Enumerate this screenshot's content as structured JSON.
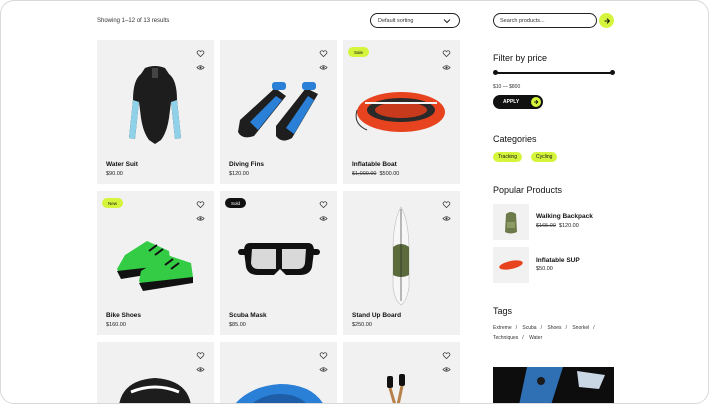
{
  "toolbar": {
    "results_text": "Showing 1–12 of 13 results",
    "sort_value": "Default sorting"
  },
  "products": [
    {
      "name": "Water Suit",
      "price": "$90.00",
      "old_price": "",
      "badge": ""
    },
    {
      "name": "Diving Fins",
      "price": "$120.00",
      "old_price": "",
      "badge": ""
    },
    {
      "name": "Inflatable Boat",
      "price": "$500.00",
      "old_price": "$1,000.00",
      "badge": "Sale"
    },
    {
      "name": "Bike Shoes",
      "price": "$160.00",
      "old_price": "",
      "badge": "New"
    },
    {
      "name": "Scuba Mask",
      "price": "$85.00",
      "old_price": "",
      "badge": "Sold"
    },
    {
      "name": "Stand Up Board",
      "price": "$250.00",
      "old_price": "",
      "badge": ""
    }
  ],
  "sidebar": {
    "search_placeholder": "Search products...",
    "filter_title": "Filter by price",
    "price_range": "$10 — $800",
    "apply_label": "APPLY",
    "categories_title": "Categories",
    "categories": [
      "Tracking",
      "Cycling"
    ],
    "popular_title": "Popular Products",
    "popular": [
      {
        "name": "Walking Backpack",
        "old_price": "$165.00",
        "price": "$120.00"
      },
      {
        "name": "Inflatable SUP",
        "old_price": "",
        "price": "$50.00"
      }
    ],
    "tags_title": "Tags",
    "tags": [
      "Extreme",
      "Scuba",
      "Shoes",
      "Snorkel",
      "Techniques",
      "Water"
    ]
  },
  "colors": {
    "accent": "#d4f53c",
    "card_bg": "#f1f1f1",
    "dark": "#111111"
  },
  "icons": [
    "heart-icon",
    "eye-icon",
    "chevron-down-icon",
    "arrow-right-icon"
  ]
}
